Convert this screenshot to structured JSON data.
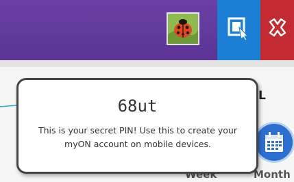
{
  "header": {
    "avatar_icon": "ladybug-avatar-icon",
    "pin_button_icon": "pin-code-icon",
    "close_button_icon": "close-icon",
    "colors": {
      "bar": "#5b3496",
      "pin_button": "#1c7fd6",
      "close_button": "#c42a31"
    }
  },
  "page": {
    "school_label": "OL",
    "calendar_icon": "calendar-icon",
    "week_label": "Week",
    "month_label": "Month"
  },
  "tooltip": {
    "pin": "68ut",
    "description": "This is your secret PIN! Use this to create your myON account on mobile devices."
  }
}
